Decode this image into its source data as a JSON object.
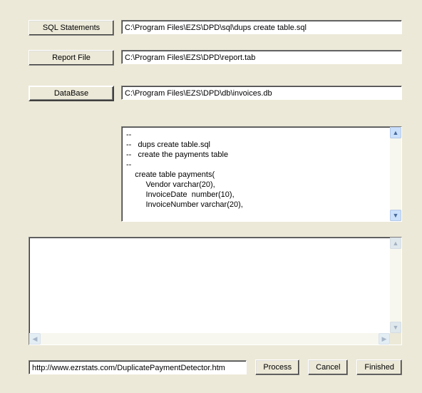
{
  "rows": {
    "sql": {
      "button": "SQL Statements",
      "value": "C:\\Program Files\\EZS\\DPD\\sql\\dups create table.sql"
    },
    "report": {
      "button": "Report File",
      "value": "C:\\Program Files\\EZS\\DPD\\report.tab"
    },
    "db": {
      "button": "DataBase",
      "value": "C:\\Program Files\\EZS\\DPD\\db\\invoices.db"
    }
  },
  "code": "--\n--   dups create table.sql\n--   create the payments table\n--\n    create table payments(\n         Vendor varchar(20),\n         InvoiceDate  number(10),\n         InvoiceNumber varchar(20),",
  "log": "",
  "url": "http://www.ezrstats.com/DuplicatePaymentDetector.htm",
  "actions": {
    "process": "Process",
    "cancel": "Cancel",
    "finished": "Finished"
  },
  "glyphs": {
    "up": "▲",
    "down": "▼",
    "left": "◀",
    "right": "▶"
  }
}
